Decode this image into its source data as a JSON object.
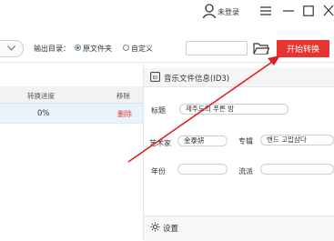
{
  "titlebar": {
    "login_label": "未登录"
  },
  "toolbar": {
    "output_dir_label": "输出目录：",
    "radio_source_label": "原文件夹",
    "radio_custom_label": "自定义",
    "start_button_label": "开始转换"
  },
  "table": {
    "headers": [
      "转换进度",
      "移除"
    ],
    "rows": [
      {
        "progress": "0%",
        "action": "删除"
      }
    ]
  },
  "info_panel": {
    "title": "音乐文件信息(ID3)",
    "fields": {
      "title_label": "标题",
      "title_value": "제주도의 푸른 밤",
      "artist_label": "艺术家",
      "artist_value": "金泰妍",
      "genre_label": "专辑",
      "genre_value": "밴드 고맙삼다",
      "year_label": "年份",
      "year_value": "",
      "style_label": "流派",
      "style_value": ""
    }
  },
  "settings": {
    "label": "设置"
  },
  "colors": {
    "accent": "#e8332f",
    "selected_row": "#e8f4fd",
    "radio_on": "#1a9a33"
  },
  "icons": [
    "user-icon",
    "menu-icon",
    "minimize-icon",
    "maximize-icon",
    "close-icon",
    "folder-icon",
    "id3-icon",
    "settings-icon"
  ]
}
